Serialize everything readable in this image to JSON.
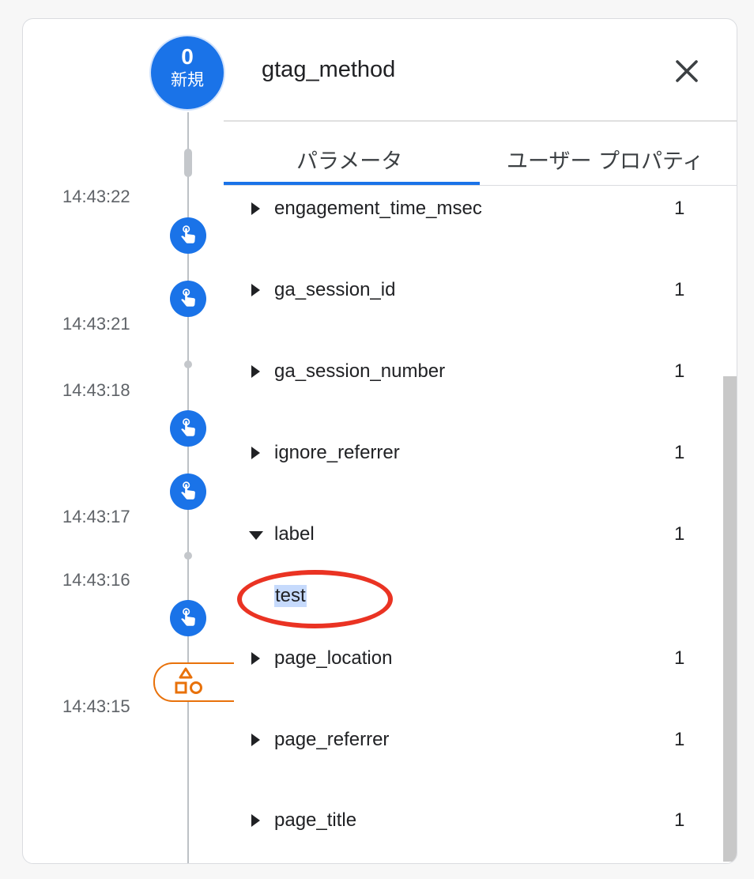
{
  "timeline": {
    "counter": {
      "value": "0",
      "label": "新規"
    },
    "timestamps": [
      "14:43:22",
      "14:43:21",
      "14:43:18",
      "14:43:17",
      "14:43:16",
      "14:43:15"
    ]
  },
  "panel": {
    "title": "gtag_method",
    "tabs": [
      {
        "label": "パラメータ",
        "active": true
      },
      {
        "label": "ユーザー プロパティ",
        "active": false
      }
    ],
    "params": [
      {
        "name": "engagement_time_msec",
        "count": "1",
        "expanded": false
      },
      {
        "name": "ga_session_id",
        "count": "1",
        "expanded": false
      },
      {
        "name": "ga_session_number",
        "count": "1",
        "expanded": false
      },
      {
        "name": "ignore_referrer",
        "count": "1",
        "expanded": false
      },
      {
        "name": "label",
        "count": "1",
        "expanded": true,
        "value": "test"
      },
      {
        "name": "page_location",
        "count": "1",
        "expanded": false
      },
      {
        "name": "page_referrer",
        "count": "1",
        "expanded": false
      },
      {
        "name": "page_title",
        "count": "1",
        "expanded": false
      }
    ]
  },
  "colors": {
    "accent": "#1a73e8",
    "config_event": "#e8710a",
    "annotation": "#ea3323",
    "selection": "#c6dafc"
  },
  "icons": {
    "event": "touch-hand-icon",
    "config": "shapes-icon",
    "close": "close-icon"
  }
}
